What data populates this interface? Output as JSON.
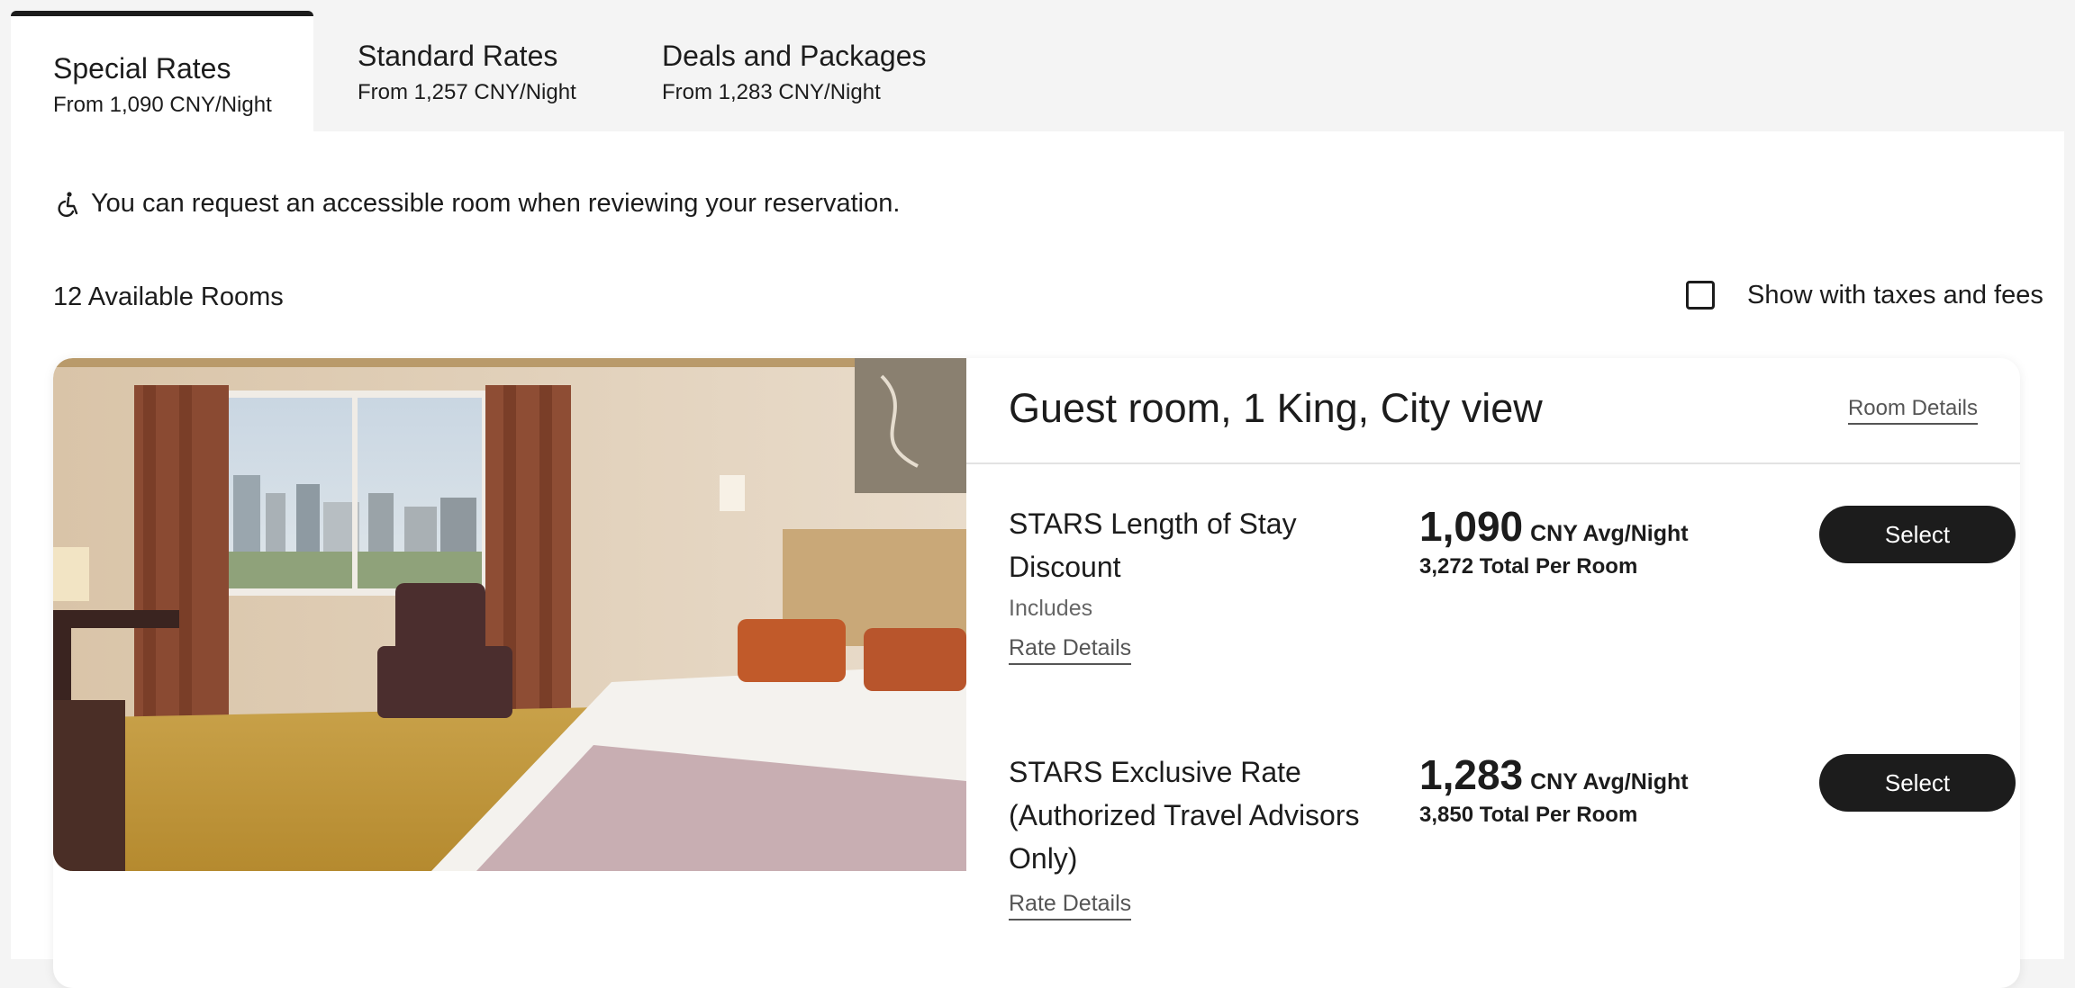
{
  "tabs": [
    {
      "title": "Special Rates",
      "subtitle": "From 1,090 CNY/Night"
    },
    {
      "title": "Standard Rates",
      "subtitle": "From 1,257 CNY/Night"
    },
    {
      "title": "Deals and Packages",
      "subtitle": "From 1,283 CNY/Night"
    }
  ],
  "notice": {
    "icon": "wheelchair-icon",
    "text": "You can request an accessible room when reviewing your reservation."
  },
  "rooms_count": "12 Available Rooms",
  "tax_toggle": {
    "label": "Show with taxes and fees",
    "checked": false
  },
  "room": {
    "name": "Guest room, 1 King, City view",
    "details_link": "Room Details",
    "rates": [
      {
        "name": "STARS Length of Stay Discount",
        "includes": "Includes",
        "details_link": "Rate Details",
        "price": "1,090",
        "price_unit": "CNY Avg/Night",
        "total": "3,272 Total Per Room",
        "button": "Select"
      },
      {
        "name": "STARS Exclusive Rate (Authorized Travel Advisors Only)",
        "includes": "",
        "details_link": "Rate Details",
        "price": "1,283",
        "price_unit": "CNY Avg/Night",
        "total": "3,850 Total Per Room",
        "button": "Select"
      }
    ]
  },
  "colors": {
    "accent_dark": "#1c1c1c",
    "tab_bar": "#f4f4f4"
  }
}
